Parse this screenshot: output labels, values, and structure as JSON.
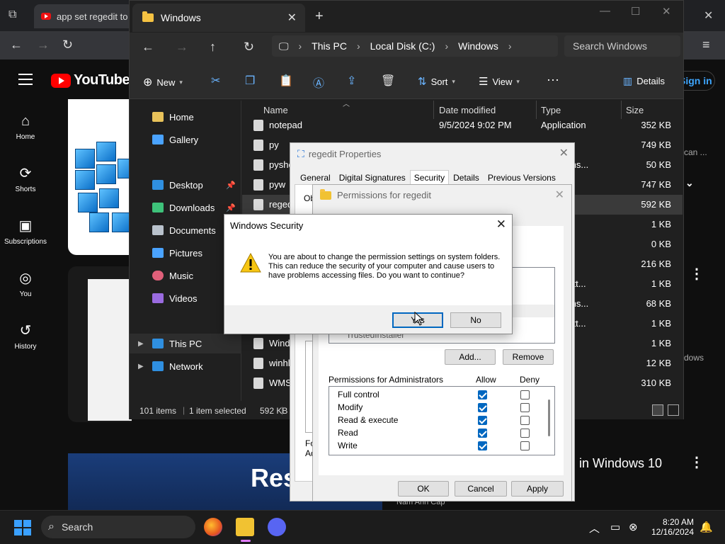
{
  "browser": {
    "tab_title": "app set regedit to -",
    "signin_label": "Sign in"
  },
  "youtube": {
    "brand": "YouTube",
    "nav": [
      {
        "label": "Home"
      },
      {
        "label": "Shorts"
      },
      {
        "label": "Subscriptions"
      },
      {
        "label": "You"
      },
      {
        "label": "History"
      }
    ],
    "thumb3_text": "Res",
    "side_text": "in Windows 10",
    "side_snippet_1": "can ...",
    "side_snippet_2": "dows",
    "channel_name": "Nam Anh Cap"
  },
  "explorer": {
    "tab_title": "Windows",
    "breadcrumb": [
      "This PC",
      "Local Disk (C:)",
      "Windows"
    ],
    "search_placeholder": "Search Windows",
    "toolbar": {
      "new_label": "New",
      "sort_label": "Sort",
      "view_label": "View",
      "more_label": "···",
      "details_label": "Details"
    },
    "nav_pane": [
      {
        "label": "Home",
        "color": "#e8c25a"
      },
      {
        "label": "Gallery",
        "color": "#4aa3ff"
      },
      {
        "label": "Desktop",
        "color": "#2f8fe0"
      },
      {
        "label": "Downloads",
        "color": "#3ec27a"
      },
      {
        "label": "Documents",
        "color": "#b9c2cc"
      },
      {
        "label": "Pictures",
        "color": "#4aa3ff"
      },
      {
        "label": "Music",
        "color": "#e0607a"
      },
      {
        "label": "Videos",
        "color": "#9a6be0"
      },
      {
        "label": "This PC",
        "color": "#2f8fe0"
      },
      {
        "label": "Network",
        "color": "#2f8fe0"
      }
    ],
    "columns": [
      "Name",
      "Date modified",
      "Type",
      "Size"
    ],
    "files": [
      {
        "name": "notepad",
        "date": "9/5/2024 9:02 PM",
        "type": "Application",
        "size": "352 KB"
      },
      {
        "name": "py",
        "date": "",
        "type": "on",
        "size": "749 KB"
      },
      {
        "name": "pyshe",
        "date": "",
        "type": "on extens...",
        "size": "50 KB"
      },
      {
        "name": "pyw",
        "date": "",
        "type": "on",
        "size": "747 KB"
      },
      {
        "name": "reged",
        "date": "",
        "type": "on",
        "size": "592 KB"
      },
      {
        "name": "",
        "date": "",
        "type": "ument",
        "size": "1 KB"
      },
      {
        "name": "",
        "date": "",
        "type": "ument",
        "size": "0 KB"
      },
      {
        "name": "",
        "date": "",
        "type": "on",
        "size": "216 KB"
      },
      {
        "name": "",
        "date": "",
        "type": "ation sett...",
        "size": "1 KB"
      },
      {
        "name": "",
        "date": "",
        "type": "on extens...",
        "size": "68 KB"
      },
      {
        "name": "",
        "date": "",
        "type": "ation sett...",
        "size": "1 KB"
      },
      {
        "name": "Wind",
        "date": "",
        "type": "ument",
        "size": "1 KB"
      },
      {
        "name": "winhl",
        "date": "",
        "type": "on",
        "size": "12 KB"
      },
      {
        "name": "WMS",
        "date": "",
        "type": "",
        "size": "310 KB"
      }
    ],
    "status": {
      "items": "101 items",
      "selected": "1 item selected",
      "size": "592 KB"
    }
  },
  "properties_dialog": {
    "title": "regedit Properties",
    "tabs": [
      "General",
      "Digital Signatures",
      "Security",
      "Details",
      "Previous Versions"
    ],
    "partial_label_1": "Ob",
    "partial_label_2": "Fo",
    "partial_label_3": "Ad"
  },
  "permissions_dialog": {
    "title": "Permissions for regedit",
    "user_visible": "TrustedInstaller",
    "add_label": "Add...",
    "remove_label": "Remove",
    "perm_header": "Permissions for Administrators",
    "allow_label": "Allow",
    "deny_label": "Deny",
    "permissions": [
      {
        "name": "Full control",
        "allow": true,
        "deny": false
      },
      {
        "name": "Modify",
        "allow": true,
        "deny": false
      },
      {
        "name": "Read & execute",
        "allow": true,
        "deny": false
      },
      {
        "name": "Read",
        "allow": true,
        "deny": false
      },
      {
        "name": "Write",
        "allow": true,
        "deny": false
      }
    ],
    "ok_label": "OK",
    "cancel_label": "Cancel",
    "apply_label": "Apply"
  },
  "security_dialog": {
    "title": "Windows Security",
    "message": "You are about to change the permission settings on system folders. This can reduce the security of your computer and cause users to have problems accessing files. Do you want to continue?",
    "yes_label": "Yes",
    "no_label": "No"
  },
  "taskbar": {
    "search_label": "Search",
    "time": "8:20 AM",
    "date": "12/16/2024"
  },
  "colors": {
    "accent": "#0067c0",
    "youtube_red": "#ff0000",
    "explorer_bg": "#202020"
  }
}
